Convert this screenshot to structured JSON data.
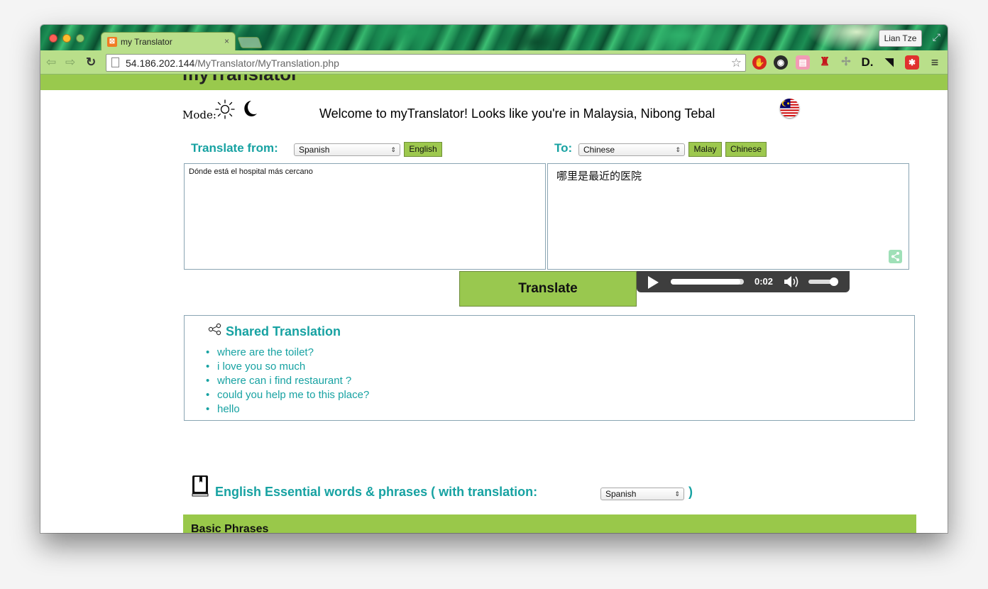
{
  "browser": {
    "tab_title": "my Translator",
    "tab_close": "×",
    "profile_name": "Lian Tze",
    "url_host": "54.186.202.144",
    "url_path": "/MyTranslator/MyTranslation.php"
  },
  "header": {
    "site_title": "myTranslator",
    "mode_label": "Mode:",
    "welcome": "Welcome to myTranslator! Looks like you're in Malaysia, Nibong Tebal"
  },
  "translator": {
    "from_label": "Translate from:",
    "from_language": "Spanish",
    "from_quick": "English",
    "to_label": "To:",
    "to_language": "Chinese",
    "to_quick": [
      "Malay",
      "Chinese"
    ],
    "source_text": "Dónde está el hospital más cercano",
    "target_text": "哪里是最近的医院",
    "translate_button": "Translate"
  },
  "audio": {
    "time": "0:02",
    "progress": 0.95,
    "volume": 0.95
  },
  "shared": {
    "title": "Shared Translation",
    "items": [
      "where are the toilet?",
      "i love you so much",
      "where can i find restaurant ?",
      "could you help me to this place?",
      "hello"
    ]
  },
  "essentials": {
    "title": "English Essential words & phrases ( with translation:",
    "close_paren": ")",
    "language": "Spanish",
    "sections": [
      "Basic Phrases"
    ]
  },
  "colors": {
    "accent_green": "#99c84f",
    "teal": "#17a2a2"
  }
}
